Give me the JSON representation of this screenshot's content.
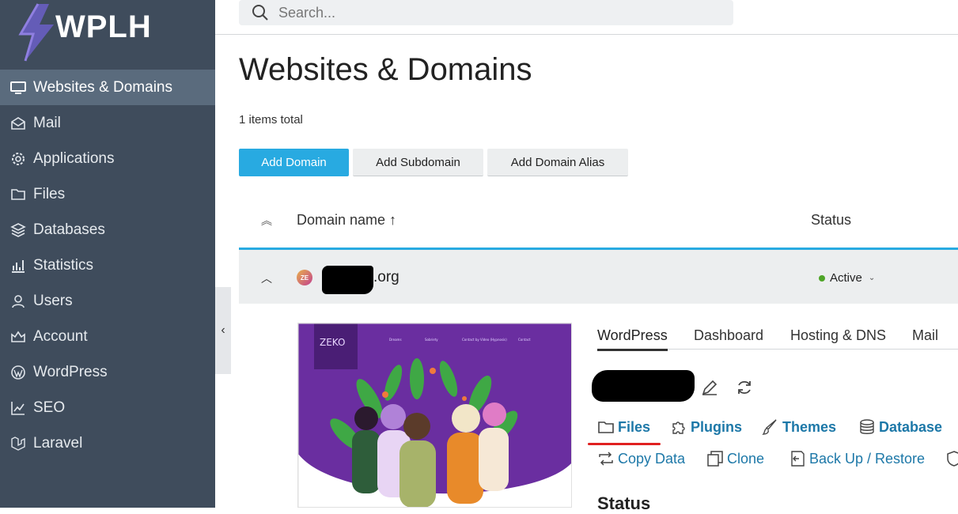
{
  "brand": {
    "name": "WPLH"
  },
  "sidebar": {
    "items": [
      {
        "label": "Websites & Domains",
        "icon": "monitor-icon",
        "active": true
      },
      {
        "label": "Mail",
        "icon": "mail-icon"
      },
      {
        "label": "Applications",
        "icon": "gear-icon"
      },
      {
        "label": "Files",
        "icon": "folder-icon"
      },
      {
        "label": "Databases",
        "icon": "database-icon"
      },
      {
        "label": "Statistics",
        "icon": "bar-chart-icon"
      },
      {
        "label": "Users",
        "icon": "user-icon"
      },
      {
        "label": "Account",
        "icon": "account-icon"
      },
      {
        "label": "WordPress",
        "icon": "wordpress-icon"
      },
      {
        "label": "SEO",
        "icon": "seo-chart-icon"
      },
      {
        "label": "Laravel",
        "icon": "laravel-icon"
      }
    ]
  },
  "search": {
    "placeholder": "Search..."
  },
  "main": {
    "title": "Websites & Domains",
    "items_total": "1 items total",
    "buttons": {
      "add_domain": "Add Domain",
      "add_subdomain": "Add Subdomain",
      "add_alias": "Add Domain Alias"
    },
    "columns": {
      "domain": "Domain name ↑",
      "status": "Status"
    }
  },
  "domain": {
    "name_suffix": ".org",
    "favicon_text": "ZE",
    "status": "Active",
    "status_color": "#4ea527",
    "tabs": [
      "WordPress",
      "Dashboard",
      "Hosting & DNS",
      "Mail"
    ],
    "actions": {
      "files": "Files",
      "plugins": "Plugins",
      "themes": "Themes",
      "database": "Database",
      "copy_data": "Copy Data",
      "clone": "Clone",
      "backup": "Back Up / Restore"
    },
    "status_heading": "Status"
  },
  "preview": {
    "logo": "ZEKO",
    "nav": [
      "Dreams",
      "Sobriety",
      "Contact by Video (Hypnosis)",
      "Contact"
    ]
  },
  "colors": {
    "accent": "#28aae1",
    "sidebar": "#3f4c5c",
    "link": "#1d78a8",
    "preview_bg": "#6a2ea0"
  }
}
